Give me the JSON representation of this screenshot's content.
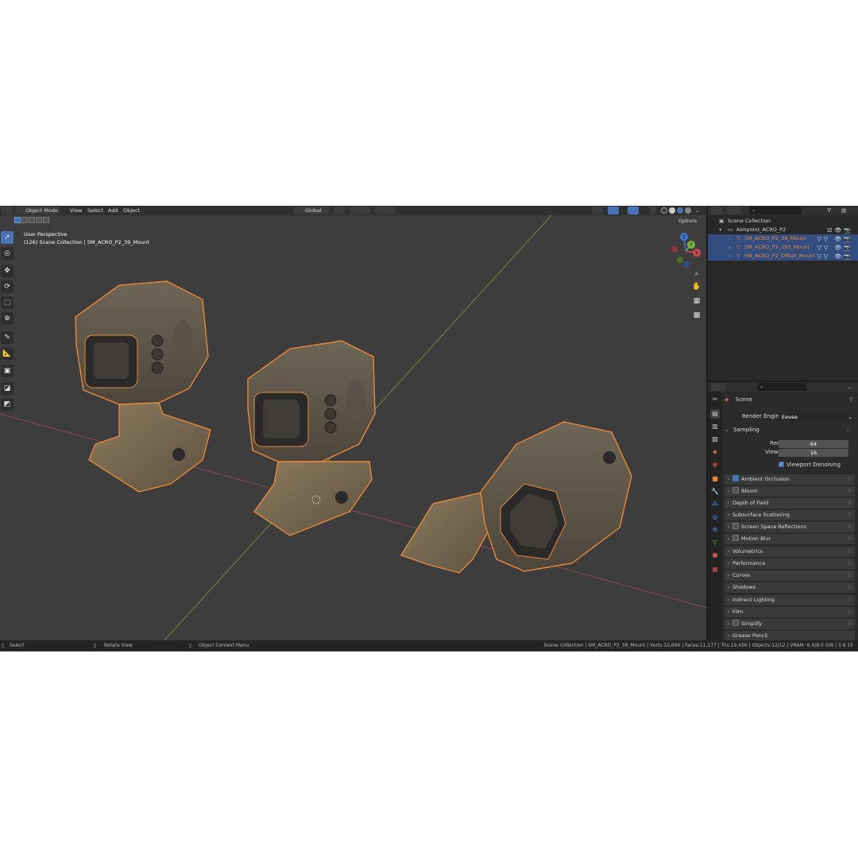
{
  "header": {
    "mode": "Object Mode",
    "menus": [
      "View",
      "Select",
      "Add",
      "Object"
    ],
    "transform_orientation": "Global"
  },
  "viewport": {
    "view_name": "User Perspective",
    "collection_info": "(126) Scene Collection | SM_ACRO_P2_39_Mount",
    "options_label": "Options",
    "gizmo_axes": {
      "x": "X",
      "y": "Y",
      "z": "Z"
    }
  },
  "colors": {
    "selection_outline": "#e8893a",
    "active_blue": "#4772b3",
    "viewport_bg": "#3d3d3d"
  },
  "outliner": {
    "root": "Scene Collection",
    "collection": "Aimpoint_ACRO_P2",
    "items": [
      {
        "label": "SM_ACRO_P2_39_Mount"
      },
      {
        "label": "SM_ACRO_P2_193_Mount"
      },
      {
        "label": "SM_ACRO_P2_Offset_Mount"
      }
    ]
  },
  "properties": {
    "context": "Scene",
    "render_engine_label": "Render Engine",
    "render_engine": "Eevee",
    "sampling": {
      "title": "Sampling",
      "render_label": "Render",
      "render_value": "64",
      "viewport_label": "Viewport",
      "viewport_value": "16",
      "denoise_label": "Viewport Denoising"
    },
    "panels": [
      "Ambient Occlusion",
      "Bloom",
      "Depth of Field",
      "Subsurface Scattering",
      "Screen Space Reflections",
      "Motion Blur",
      "Volumetrics",
      "Performance",
      "Curves",
      "Shadows",
      "Indirect Lighting",
      "Film",
      "Simplify",
      "Grease Pencil"
    ]
  },
  "statusbar": {
    "select": "Select",
    "rotate": "Rotate View",
    "context_menu": "Object Context Menu",
    "stats": "Scene Collection | SM_ACRO_P2_39_Mount | Verts:10,696 | Faces:11,177 | Tris:19,456 | Objects:12/12 | VRAM: 6.9/8.0 GiB | 3.6.15"
  }
}
